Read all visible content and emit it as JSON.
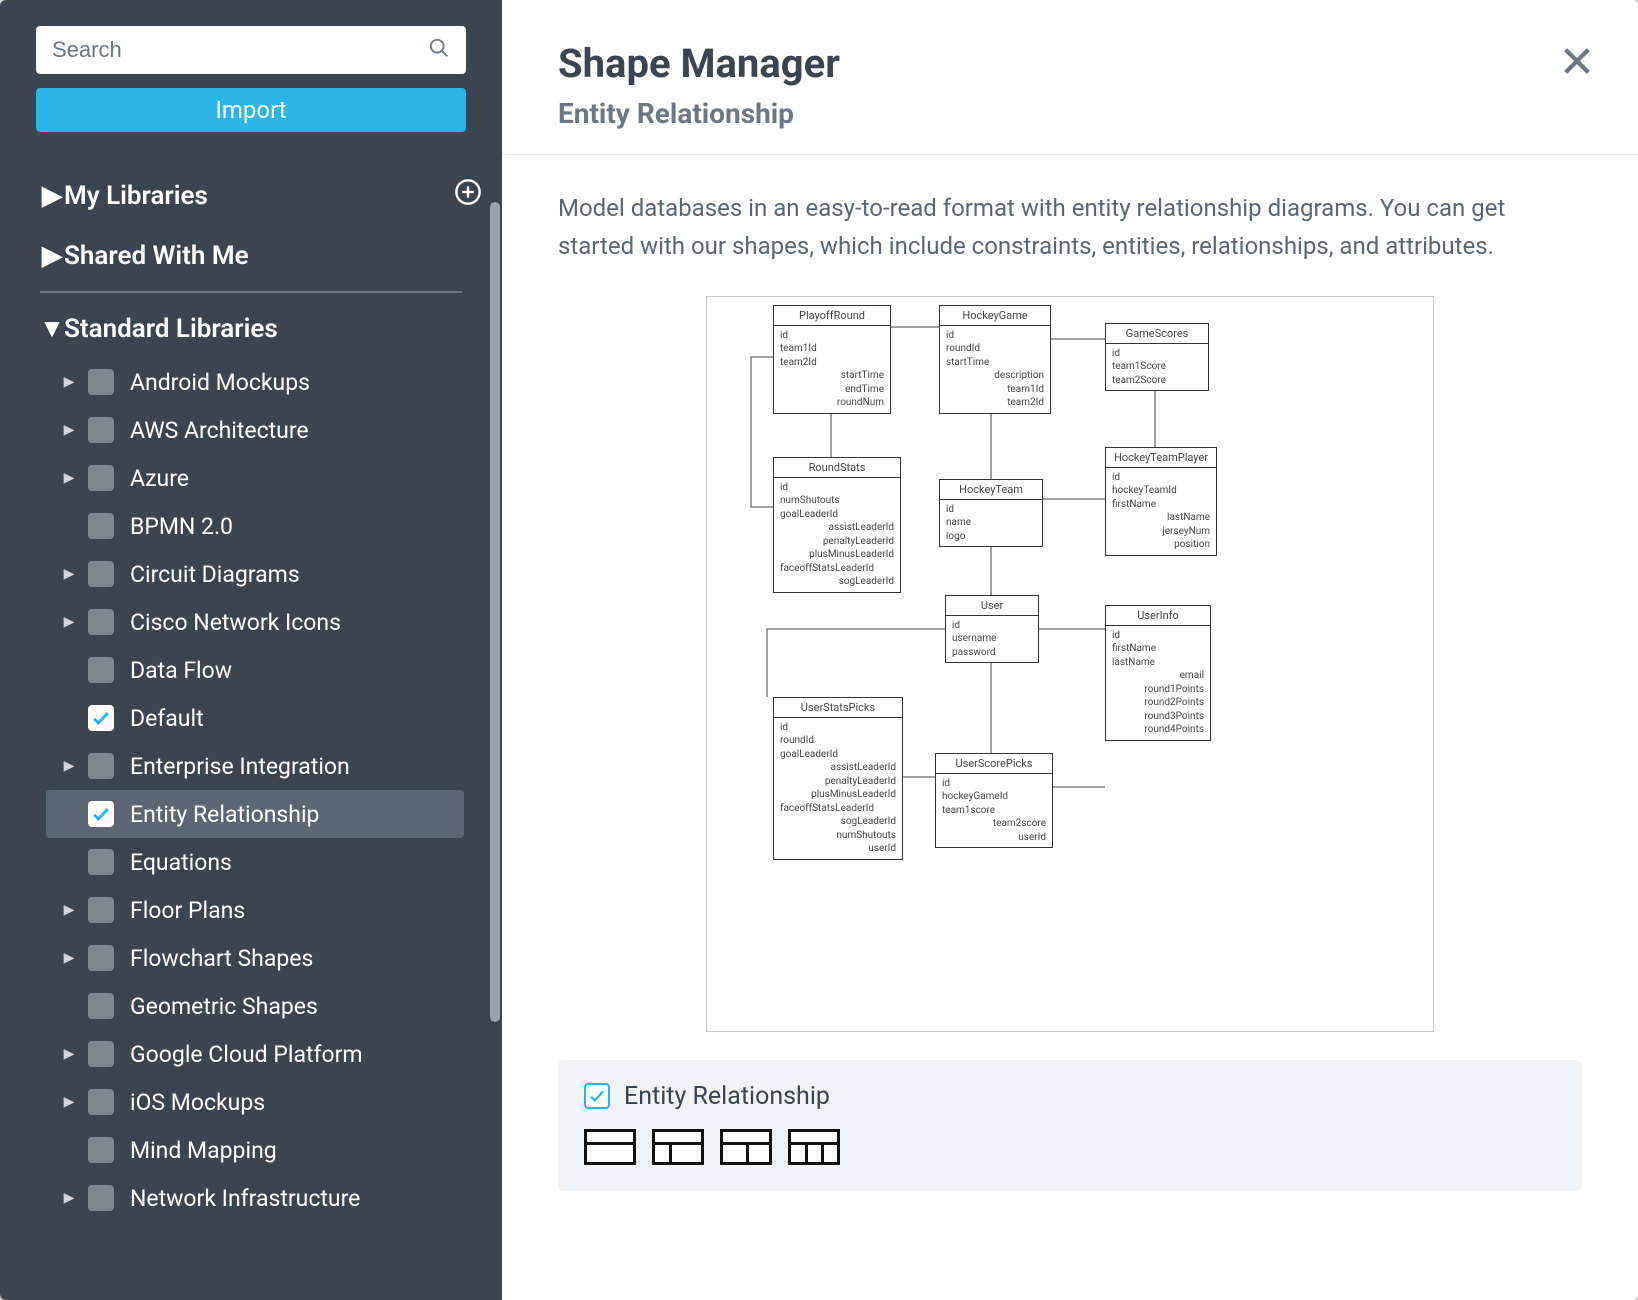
{
  "search": {
    "placeholder": "Search"
  },
  "import_label": "Import",
  "groups": {
    "my_libraries": "My Libraries",
    "shared_with_me": "Shared With Me",
    "standard_libraries": "Standard Libraries"
  },
  "libraries": [
    {
      "label": "Android Mockups",
      "expandable": true,
      "checked": false
    },
    {
      "label": "AWS Architecture",
      "expandable": true,
      "checked": false
    },
    {
      "label": "Azure",
      "expandable": true,
      "checked": false
    },
    {
      "label": "BPMN 2.0",
      "expandable": false,
      "checked": false
    },
    {
      "label": "Circuit Diagrams",
      "expandable": true,
      "checked": false
    },
    {
      "label": "Cisco Network Icons",
      "expandable": true,
      "checked": false
    },
    {
      "label": "Data Flow",
      "expandable": false,
      "checked": false
    },
    {
      "label": "Default",
      "expandable": false,
      "checked": true
    },
    {
      "label": "Enterprise Integration",
      "expandable": true,
      "checked": false
    },
    {
      "label": "Entity Relationship",
      "expandable": false,
      "checked": true,
      "selected": true
    },
    {
      "label": "Equations",
      "expandable": false,
      "checked": false
    },
    {
      "label": "Floor Plans",
      "expandable": true,
      "checked": false
    },
    {
      "label": "Flowchart Shapes",
      "expandable": true,
      "checked": false
    },
    {
      "label": "Geometric Shapes",
      "expandable": false,
      "checked": false
    },
    {
      "label": "Google Cloud Platform",
      "expandable": true,
      "checked": false
    },
    {
      "label": "iOS Mockups",
      "expandable": true,
      "checked": false
    },
    {
      "label": "Mind Mapping",
      "expandable": false,
      "checked": false
    },
    {
      "label": "Network Infrastructure",
      "expandable": true,
      "checked": false
    }
  ],
  "main": {
    "title": "Shape Manager",
    "subtitle": "Entity Relationship",
    "description": "Model databases in an easy-to-read format with entity relationship diagrams. You can get started with our shapes, which include constraints, entities, relationships, and attributes."
  },
  "category": {
    "label": "Entity Relationship"
  },
  "preview_entities": {
    "PlayoffRound": [
      "id",
      "team1Id",
      "team2Id",
      "startTime",
      "endTime",
      "roundNum"
    ],
    "HockeyGame": [
      "id",
      "roundId",
      "startTime",
      "description",
      "team1Id",
      "team2Id"
    ],
    "GameScores": [
      "id",
      "team1Score",
      "team2Score"
    ],
    "RoundStats": [
      "id",
      "numShutouts",
      "goalLeaderId",
      "assistLeaderId",
      "penaltyLeaderId",
      "plusMinusLeaderId",
      "faceoffStatsLeaderId",
      "sogLeaderId"
    ],
    "HockeyTeam": [
      "id",
      "name",
      "logo"
    ],
    "HockeyTeamPlayer": [
      "id",
      "hockeyTeamId",
      "firstName",
      "lastName",
      "jerseyNum",
      "position"
    ],
    "User": [
      "id",
      "username",
      "password"
    ],
    "UserInfo": [
      "id",
      "firstName",
      "lastName",
      "email",
      "round1Points",
      "round2Points",
      "round3Points",
      "round4Points"
    ],
    "UserStatsPicks": [
      "id",
      "roundId",
      "goalLeaderId",
      "assistLeaderId",
      "penaltyLeaderId",
      "plusMinusLeaderId",
      "faceoffStatsLeaderId",
      "sogLeaderId",
      "numShutouts",
      "userId"
    ],
    "UserScorePicks": [
      "id",
      "hockeyGameId",
      "team1score",
      "team2score",
      "userId"
    ]
  }
}
